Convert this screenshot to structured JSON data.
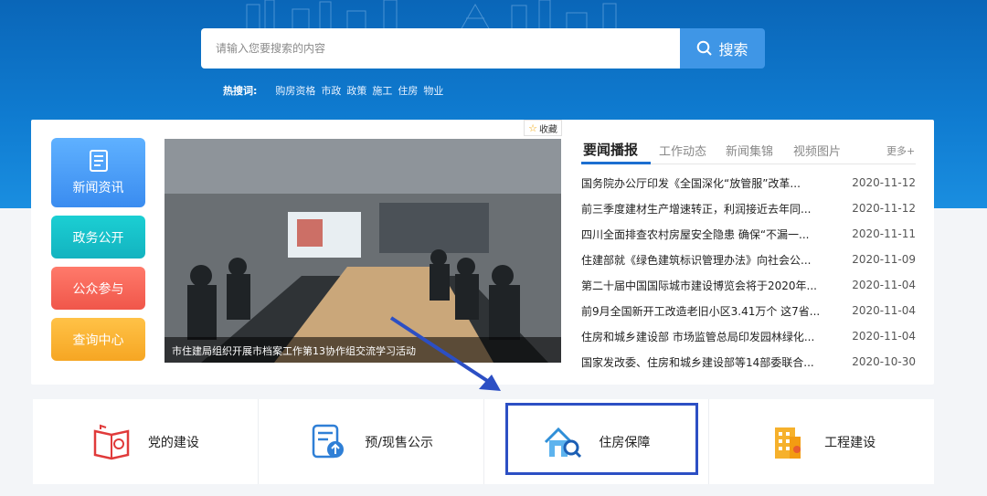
{
  "header": {
    "search_placeholder": "请输入您要搜索的内容",
    "search_button": "搜索",
    "hot_label": "热搜词:",
    "hot_words": [
      "购房资格",
      "市政",
      "政策",
      "施工",
      "住房",
      "物业"
    ]
  },
  "favorite": {
    "label": "收藏"
  },
  "side_nav": [
    {
      "label": "新闻资讯",
      "icon": "document-icon"
    },
    {
      "label": "政务公开"
    },
    {
      "label": "公众参与"
    },
    {
      "label": "查询中心"
    }
  ],
  "feature": {
    "caption": "市住建局组织开展市档案工作第13协作组交流学习活动"
  },
  "news": {
    "tabs": [
      "要闻播报",
      "工作动态",
      "新闻集锦",
      "视频图片"
    ],
    "more": "更多+",
    "items": [
      {
        "title": "国务院办公厅印发《全国深化“放管服”改革...",
        "date": "2020-11-12"
      },
      {
        "title": "前三季度建材生产增速转正，利润接近去年同...",
        "date": "2020-11-12"
      },
      {
        "title": "四川全面排查农村房屋安全隐患 确保“不漏一...",
        "date": "2020-11-11"
      },
      {
        "title": "住建部就《绿色建筑标识管理办法》向社会公...",
        "date": "2020-11-09"
      },
      {
        "title": "第二十届中国国际城市建设博览会将于2020年...",
        "date": "2020-11-04"
      },
      {
        "title": "前9月全国新开工改造老旧小区3.41万个 这7省...",
        "date": "2020-11-04"
      },
      {
        "title": "住房和城乡建设部 市场监管总局印发园林绿化...",
        "date": "2020-11-04"
      },
      {
        "title": "国家发改委、住房和城乡建设部等14部委联合...",
        "date": "2020-10-30"
      }
    ]
  },
  "services": [
    {
      "label": "党的建设",
      "icon": "party-book-icon"
    },
    {
      "label": "预/现售公示",
      "icon": "document-upload-icon"
    },
    {
      "label": "住房保障",
      "icon": "house-search-icon"
    },
    {
      "label": "工程建设",
      "icon": "building-icon"
    }
  ],
  "colors": {
    "primary": "#1c6fd0",
    "highlight": "#2c4fc4"
  }
}
